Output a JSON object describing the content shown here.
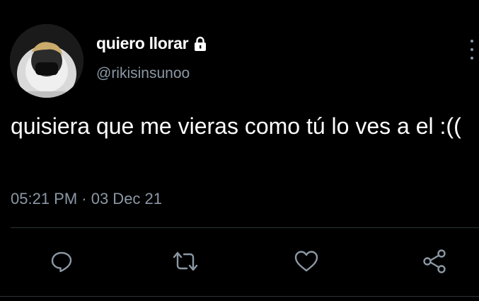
{
  "user": {
    "display_name": "quiero llorar",
    "handle": "@rikisinsunoo",
    "avatar_icon": "profile-photo",
    "protected_icon": "lock-icon"
  },
  "tweet": {
    "text": "quisiera que me vieras como tú lo ves a el :((",
    "timestamp": "05:21 PM · 03 Dec 21"
  },
  "actions": [
    {
      "name": "reply",
      "icon": "reply-icon"
    },
    {
      "name": "retweet",
      "icon": "retweet-icon"
    },
    {
      "name": "like",
      "icon": "heart-icon"
    },
    {
      "name": "share",
      "icon": "share-icon"
    }
  ],
  "colors": {
    "background": "#000000",
    "text_primary": "#ffffff",
    "text_secondary": "#8b98a5",
    "divider": "#2f3336"
  }
}
